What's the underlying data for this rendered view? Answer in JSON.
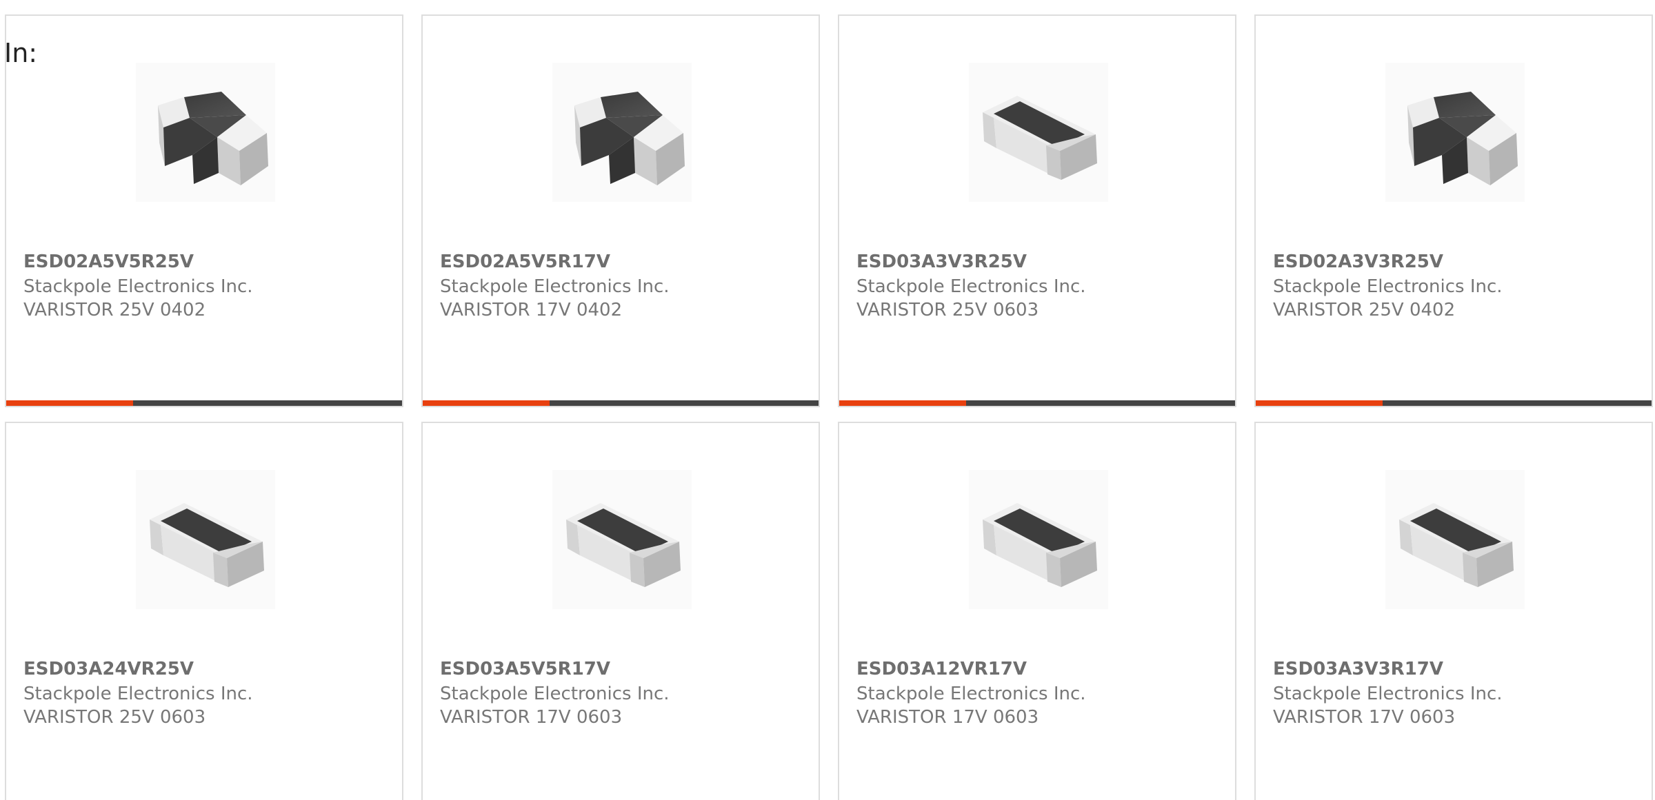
{
  "filter_label": "In:",
  "colors": {
    "accent": "#e8400f",
    "bar_dark": "#444444",
    "border": "#dddddd",
    "text": "#777777"
  },
  "products": [
    {
      "part_number": "ESD02A5V5R25V",
      "manufacturer": "Stackpole Electronics Inc.",
      "description": "VARISTOR 25V 0402",
      "image_icon": "chip-component-image"
    },
    {
      "part_number": "ESD02A5V5R17V",
      "manufacturer": "Stackpole Electronics Inc.",
      "description": "VARISTOR 17V 0402",
      "image_icon": "chip-component-image"
    },
    {
      "part_number": "ESD03A3V3R25V",
      "manufacturer": "Stackpole Electronics Inc.",
      "description": "VARISTOR 25V 0603",
      "image_icon": "chip-component-image"
    },
    {
      "part_number": "ESD02A3V3R25V",
      "manufacturer": "Stackpole Electronics Inc.",
      "description": "VARISTOR 25V 0402",
      "image_icon": "chip-component-image"
    },
    {
      "part_number": "ESD03A24VR25V",
      "manufacturer": "Stackpole Electronics Inc.",
      "description": "VARISTOR 25V 0603",
      "image_icon": "chip-component-image"
    },
    {
      "part_number": "ESD03A5V5R17V",
      "manufacturer": "Stackpole Electronics Inc.",
      "description": "VARISTOR 17V 0603",
      "image_icon": "chip-component-image"
    },
    {
      "part_number": "ESD03A12VR17V",
      "manufacturer": "Stackpole Electronics Inc.",
      "description": "VARISTOR 17V 0603",
      "image_icon": "chip-component-image"
    },
    {
      "part_number": "ESD03A3V3R17V",
      "manufacturer": "Stackpole Electronics Inc.",
      "description": "VARISTOR 17V 0603",
      "image_icon": "chip-component-image"
    }
  ]
}
